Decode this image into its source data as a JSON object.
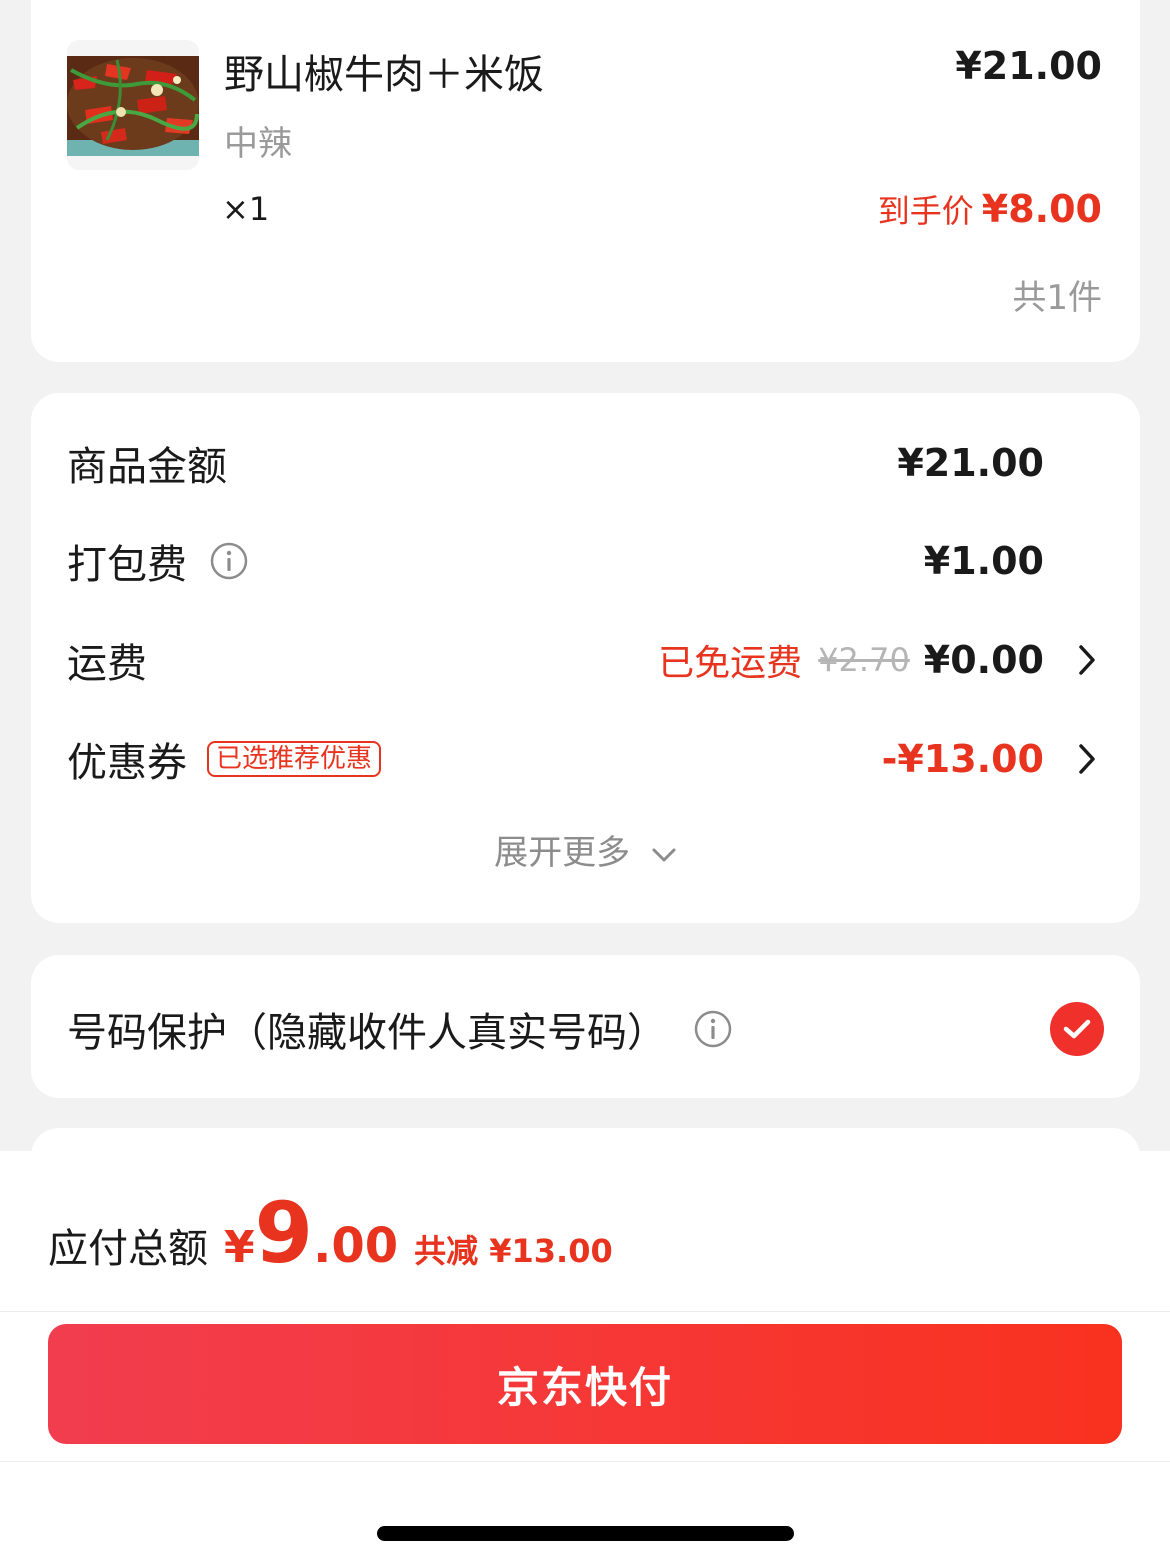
{
  "product": {
    "name": "野山椒牛肉＋米饭",
    "spec": "中辣",
    "quantity": "×1",
    "price": "¥21.00",
    "final_price_label": "到手价",
    "final_price": "¥8.00",
    "count": "共1件"
  },
  "fees": {
    "goods_amount": {
      "label": "商品金额",
      "value": "¥21.00"
    },
    "packing_fee": {
      "label": "打包费",
      "value": "¥1.00"
    },
    "shipping": {
      "label": "运费",
      "free_tag": "已免运费",
      "original": "¥2.70",
      "value": "¥0.00"
    },
    "coupon": {
      "label": "优惠券",
      "badge": "已选推荐优惠",
      "value": "-¥13.00"
    },
    "expand_label": "展开更多"
  },
  "protection": {
    "label": "号码保护（隐藏收件人真实号码）",
    "checked": true
  },
  "footer": {
    "total_label": "应付总额",
    "currency": "¥",
    "total_int": "9",
    "total_dec": ".00",
    "saved": "共减 ¥13.00",
    "pay_button": "京东快付"
  },
  "colors": {
    "accent": "#e8341f",
    "button_start": "#f23d4f",
    "button_end": "#f9321f",
    "background": "#f2f2f2"
  }
}
